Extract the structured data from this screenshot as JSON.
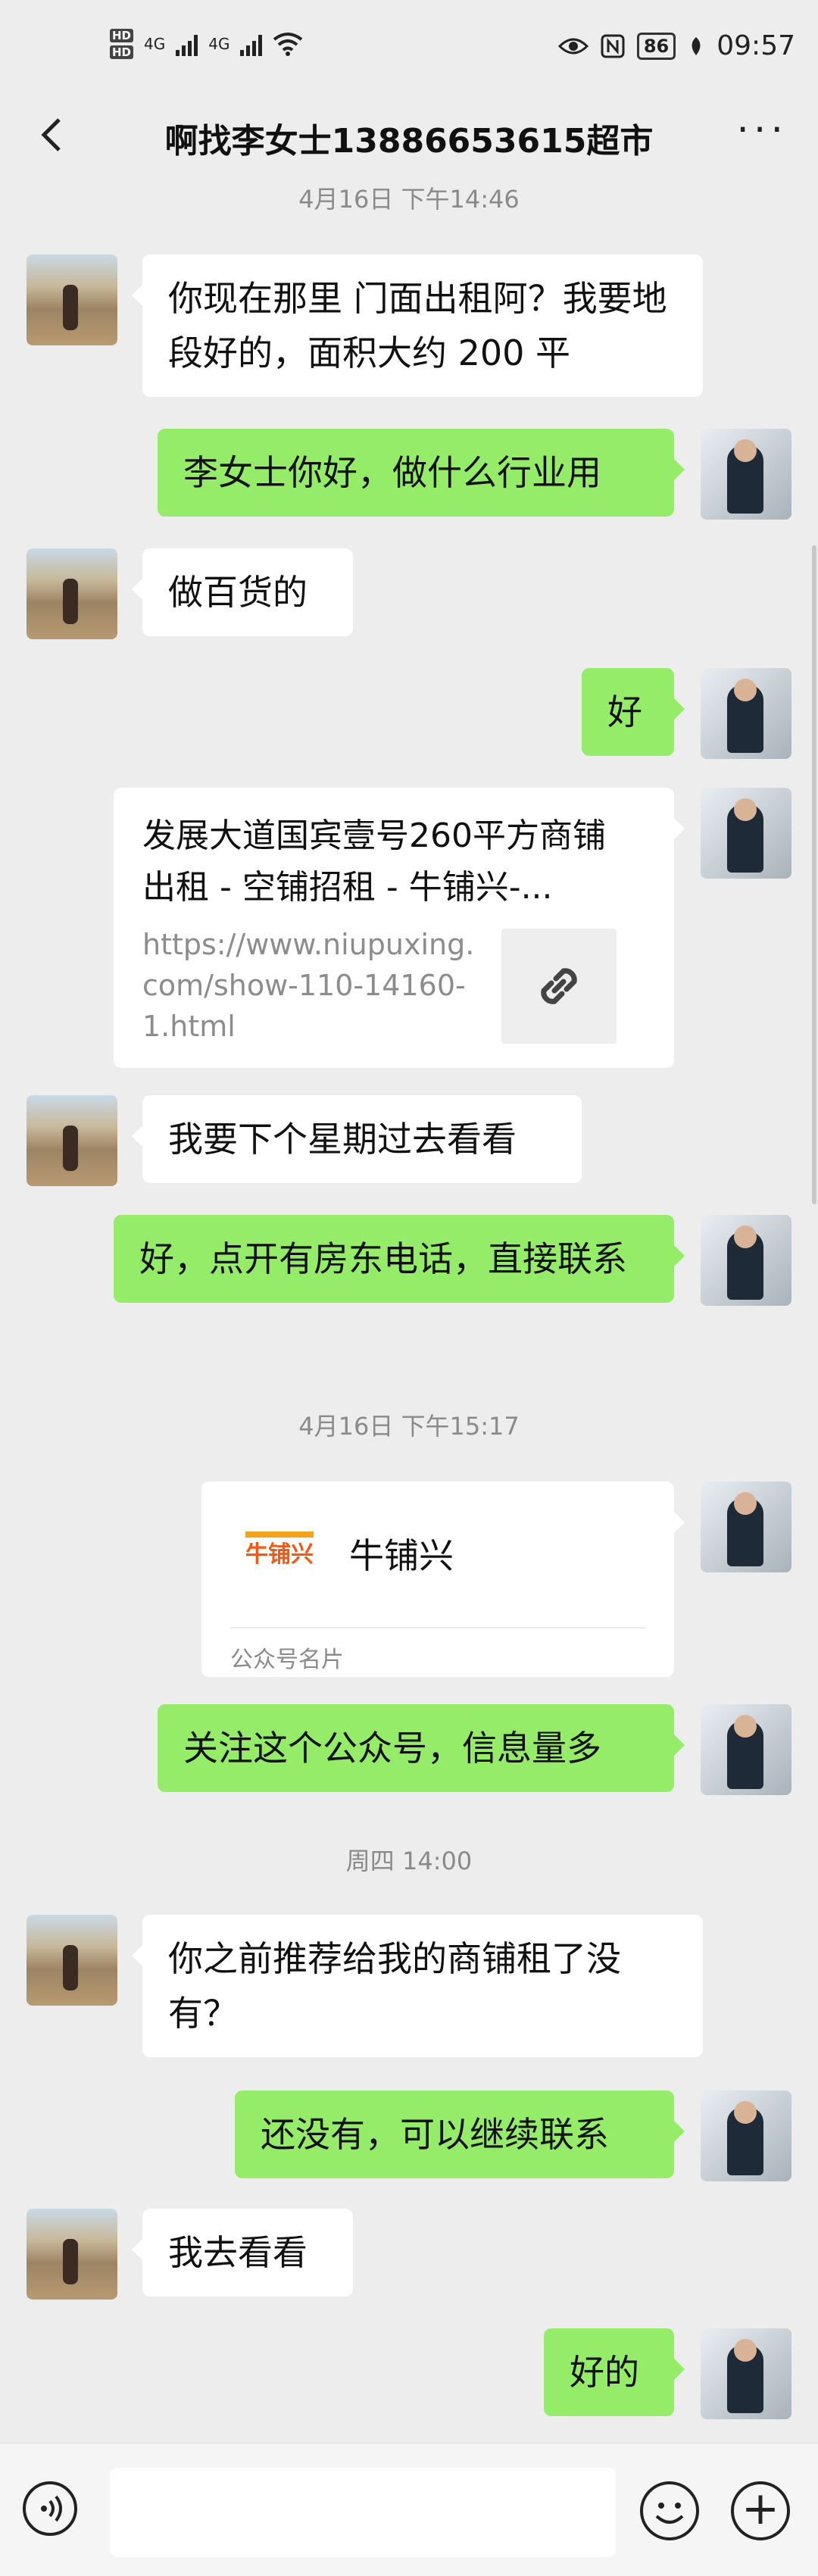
{
  "status_bar": {
    "time": "09:57",
    "battery": "86",
    "network_1": "4G",
    "network_2": "4G",
    "hd_1": "HD",
    "hd_2": "HD"
  },
  "header": {
    "title": "啊找李女士13886653615超市",
    "more": "···"
  },
  "times": [
    "4月16日 下午14:46",
    "4月16日 下午15:17",
    "周四 14:00"
  ],
  "messages": [
    {
      "from": "other",
      "text": "你现在那里 门面出租阿？我要地段好的，面积大约 200 平"
    },
    {
      "from": "me",
      "text": "李女士你好，做什么行业用"
    },
    {
      "from": "other",
      "text": "做百货的"
    },
    {
      "from": "me",
      "text": "好"
    },
    {
      "from": "me",
      "type": "link",
      "title": "发展大道国宾壹号260平方商铺出租 - 空铺招租 - 牛铺兴-...",
      "url": "https://www.niupuxing.com/show-110-14160-1.html",
      "icon": "link-icon"
    },
    {
      "from": "other",
      "text": "我要下个星期过去看看"
    },
    {
      "from": "me",
      "text": "好，点开有房东电话，直接联系"
    },
    {
      "from": "me",
      "type": "official-account-card",
      "name": "牛铺兴",
      "label": "公众号名片",
      "logo_text": "牛铺兴",
      "logo_color": "#f05a14"
    },
    {
      "from": "me",
      "text": "关注这个公众号，信息量多"
    },
    {
      "from": "other",
      "text": "你之前推荐给我的商铺租了没有？"
    },
    {
      "from": "me",
      "text": "还没有，可以继续联系"
    },
    {
      "from": "other",
      "text": "我去看看"
    },
    {
      "from": "me",
      "text": "好的"
    }
  ],
  "input_bar": {
    "placeholder": "",
    "voice_icon": "voice-icon",
    "emoji_icon": "emoji-icon",
    "plus_icon": "plus-icon"
  },
  "colors": {
    "background": "#ededed",
    "my_bubble": "#95ec69",
    "other_bubble": "#ffffff"
  }
}
